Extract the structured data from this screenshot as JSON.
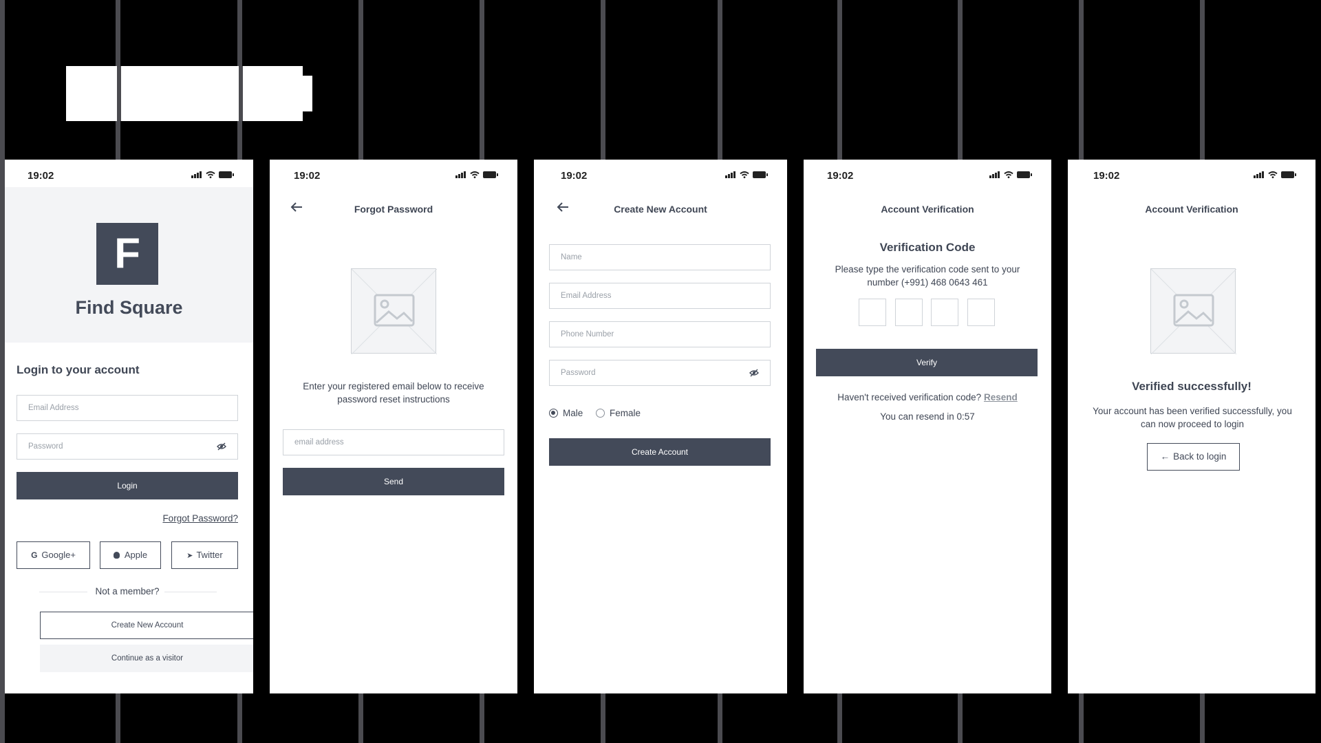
{
  "status_time": "19:02",
  "screen1": {
    "logo_letter": "F",
    "app_name": "Find Square",
    "heading": "Login to your account",
    "email_placeholder": "Email Address",
    "password_placeholder": "Password",
    "login_label": "Login",
    "forgot_link": "Forgot Password?",
    "social": [
      "Google+",
      "Apple",
      "Twitter"
    ],
    "not_member": "Not a member?",
    "create_account": "Create New Account",
    "visitor": "Continue as a visitor"
  },
  "screen2": {
    "title": "Forgot Password",
    "instructions": "Enter your registered email below to receive password reset instructions",
    "email_placeholder": "email address",
    "send_label": "Send"
  },
  "screen3": {
    "title": "Create New Account",
    "name_placeholder": "Name",
    "email_placeholder": "Email Address",
    "phone_placeholder": "Phone Number",
    "password_placeholder": "Password",
    "gender_options": [
      "Male",
      "Female"
    ],
    "gender_selected": "Male",
    "submit_label": "Create Account"
  },
  "screen4": {
    "title": "Account Verification",
    "heading": "Verification Code",
    "instructions": "Please type the verification code sent to your number (+991) 468 0643 461",
    "verify_label": "Verify",
    "not_received": "Haven't received verification code?",
    "resend_link": "Resend",
    "resend_timer": "You can resend in 0:57"
  },
  "screen5": {
    "title": "Account Verification",
    "heading": "Verified successfully!",
    "message": "Your account has been verified successfully, you can now proceed to login",
    "back_label": "Back to login"
  },
  "colors": {
    "accent": "#434a59",
    "border": "#cfd3d8",
    "background": "#000000",
    "placeholder_fill": "#f3f4f6"
  }
}
